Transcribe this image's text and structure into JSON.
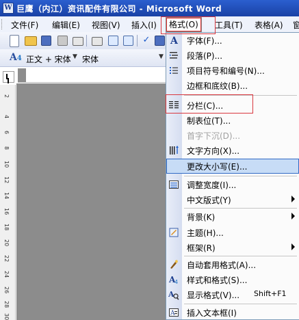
{
  "window": {
    "title": "巨鹰（内江）资讯配件有限公司 - Microsoft Word",
    "app_icon": "W"
  },
  "menubar": {
    "items": [
      {
        "label": "文件(F)"
      },
      {
        "label": "编辑(E)"
      },
      {
        "label": "视图(V)"
      },
      {
        "label": "插入(I)"
      },
      {
        "label": "格式(O)"
      },
      {
        "label": "工具(T)"
      },
      {
        "label": "表格(A)"
      },
      {
        "label": "窗"
      }
    ]
  },
  "stylebar": {
    "style_value": "正文 + 宋体",
    "font_value": "宋体"
  },
  "ruler": {
    "ticks": [
      "2",
      "4",
      "6",
      "8",
      "10",
      "12",
      "14",
      "16",
      "18",
      "20",
      "22",
      "24",
      "26",
      "28",
      "30"
    ]
  },
  "format_menu": {
    "items": [
      {
        "label": "字体(F)...",
        "icon": "font-a-icon"
      },
      {
        "label": "段落(P)...",
        "icon": "paragraph-icon"
      },
      {
        "label": "项目符号和编号(N)...",
        "icon": "bullets-icon"
      },
      {
        "label": "边框和底纹(B)...",
        "icon": ""
      },
      {
        "label": "分栏(C)...",
        "icon": "columns-icon"
      },
      {
        "label": "制表位(T)...",
        "icon": ""
      },
      {
        "label": "首字下沉(D)...",
        "icon": "",
        "disabled": true
      },
      {
        "label": "文字方向(X)...",
        "icon": "text-direction-icon"
      },
      {
        "label": "更改大小写(E)...",
        "icon": "",
        "hover": true
      },
      {
        "label": "调整宽度(I)...",
        "icon": "adjust-width-icon"
      },
      {
        "label": "中文版式(Y)",
        "icon": "",
        "submenu": true
      },
      {
        "label": "背景(K)",
        "icon": "",
        "submenu": true
      },
      {
        "label": "主题(H)...",
        "icon": "theme-icon"
      },
      {
        "label": "框架(R)",
        "icon": "",
        "submenu": true
      },
      {
        "label": "自动套用格式(A)...",
        "icon": "autoformat-icon"
      },
      {
        "label": "样式和格式(S)...",
        "icon": "styles-icon"
      },
      {
        "label": "显示格式(V)...",
        "icon": "reveal-format-icon",
        "shortcut": "Shift+F1"
      },
      {
        "label": "插入文本框(I)",
        "icon": "textbox-icon"
      }
    ]
  },
  "colors": {
    "highlight_box": "#d9363e",
    "menu_hover": "#c7dcf6",
    "title_bar": "#2b5fcf"
  }
}
